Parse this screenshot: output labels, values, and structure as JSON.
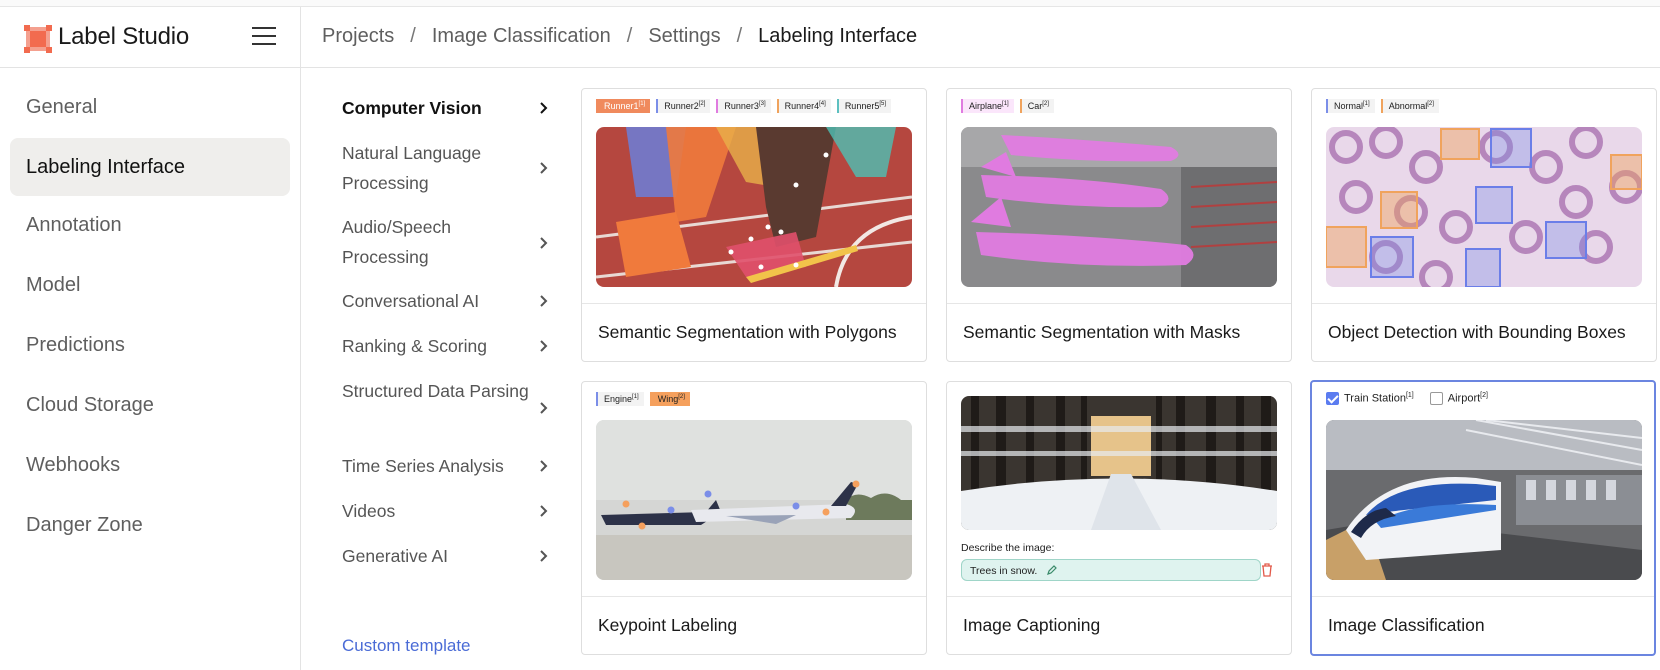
{
  "app": {
    "name": "Label Studio"
  },
  "breadcrumb": {
    "items": [
      "Projects",
      "Image Classification",
      "Settings"
    ],
    "current": "Labeling Interface",
    "separator": "/"
  },
  "sidebar": {
    "items": [
      {
        "label": "General"
      },
      {
        "label": "Labeling Interface",
        "active": true
      },
      {
        "label": "Annotation"
      },
      {
        "label": "Model"
      },
      {
        "label": "Predictions"
      },
      {
        "label": "Cloud Storage"
      },
      {
        "label": "Webhooks"
      },
      {
        "label": "Danger Zone"
      }
    ]
  },
  "categories": {
    "items": [
      {
        "label": "Computer Vision",
        "active": true
      },
      {
        "label": "Natural Language Processing"
      },
      {
        "label": "Audio/Speech Processing"
      },
      {
        "label": "Conversational AI"
      },
      {
        "label": "Ranking & Scoring"
      },
      {
        "label": "Structured Data Parsing"
      },
      {
        "label": "Time Series Analysis"
      },
      {
        "label": "Videos"
      },
      {
        "label": "Generative AI"
      }
    ],
    "custom_template": "Custom template"
  },
  "templates": [
    {
      "title": "Semantic Segmentation with Polygons",
      "labels": [
        {
          "text": "Runner1",
          "sup": "[1]",
          "color": "#f08a5d",
          "filled": true
        },
        {
          "text": "Runner2",
          "sup": "[2]",
          "color": "#7b8ee8"
        },
        {
          "text": "Runner3",
          "sup": "[3]",
          "color": "#e07be0"
        },
        {
          "text": "Runner4",
          "sup": "[4]",
          "color": "#f0a35d"
        },
        {
          "text": "Runner5",
          "sup": "[5]",
          "color": "#5dc0c0"
        }
      ]
    },
    {
      "title": "Semantic Segmentation with Masks",
      "labels": [
        {
          "text": "Airplane",
          "sup": "[1]",
          "color": "#e07be0"
        },
        {
          "text": "Car",
          "sup": "[2]",
          "color": "#f0a35d"
        }
      ]
    },
    {
      "title": "Object Detection with Bounding Boxes",
      "labels": [
        {
          "text": "Normal",
          "sup": "[1]",
          "color": "#7b8ee8"
        },
        {
          "text": "Abnormal",
          "sup": "[2]",
          "color": "#f0a35d"
        }
      ]
    },
    {
      "title": "Keypoint Labeling",
      "labels": [
        {
          "text": "Engine",
          "sup": "[1]",
          "color": "#7b8ee8"
        },
        {
          "text": "Wing",
          "sup": "[2]",
          "color": "#f5a05d",
          "filled": true
        }
      ]
    },
    {
      "title": "Image Captioning",
      "caption_label": "Describe the image:",
      "caption_value": "Trees in snow."
    },
    {
      "title": "Image Classification",
      "selected": true,
      "choices": [
        {
          "text": "Train Station",
          "sup": "[1]",
          "checked": true
        },
        {
          "text": "Airport",
          "sup": "[2]",
          "checked": false
        }
      ]
    }
  ],
  "colors": {
    "accent": "#4a6bd6",
    "active_bg": "#efeeec",
    "logo": "#f26b4f",
    "selected_border": "#6b85e0"
  }
}
